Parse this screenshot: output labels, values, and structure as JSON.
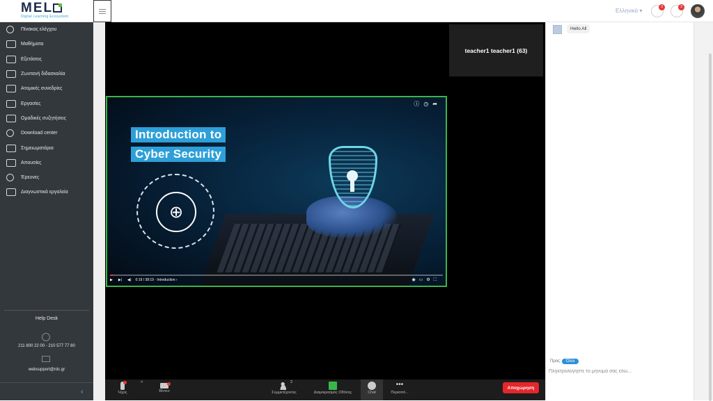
{
  "app": {
    "logo_word": "MEL",
    "logo_tag": "Digital Learning Ecosystem",
    "language": "Ελληνικά ▾",
    "notif_badges": [
      "3",
      "3"
    ]
  },
  "sidebar": {
    "items": [
      {
        "label": "Πίνακας ελέγχου",
        "icon": "dashboard-gauge-icon"
      },
      {
        "label": "Μαθήματα",
        "icon": "courses-icon"
      },
      {
        "label": "Εξετάσεις",
        "icon": "exams-icon"
      },
      {
        "label": "Ζωντανή διδασκαλία",
        "icon": "live-teaching-icon"
      },
      {
        "label": "Ατομικές συνεδρίες",
        "icon": "individual-sessions-icon"
      },
      {
        "label": "Εργασίες",
        "icon": "assignments-icon"
      },
      {
        "label": "Ομαδικές συζητήσεις",
        "icon": "group-discussions-icon"
      },
      {
        "label": "Download center",
        "icon": "download-center-icon"
      },
      {
        "label": "Σημειωματάρια",
        "icon": "notebooks-icon"
      },
      {
        "label": "Απουσίες",
        "icon": "absences-icon"
      },
      {
        "label": "Έρευνες",
        "icon": "surveys-icon"
      },
      {
        "label": "Διαγνωστικά εργαλεία",
        "icon": "diagnostic-tools-icon"
      }
    ],
    "help_desk": "Help Desk",
    "phone": "211 800 22 00 - 210 577 77 80",
    "email": "websupport@rdc.gr"
  },
  "meeting": {
    "participant_tile": "teacher1 teacher1 (63)",
    "video": {
      "title_line1": "Introduction to",
      "title_line2": "Cyber Security",
      "time": "0:19 / 38:19 · Introduction ›",
      "progress": 0.01
    },
    "controls": {
      "mic_label": "Ήχος",
      "video_label": "Βίντεο",
      "participants_label": "Συμμετέχοντες",
      "participants_count": "2",
      "share_label": "Διαμοιρασμός Οθόνης",
      "chat_label": "Chat",
      "more_label": "Περισσό...",
      "leave_label": "Αποχώρηση"
    }
  },
  "chat": {
    "messages": [
      {
        "text": "Hello All"
      }
    ],
    "to_label": "Προς:",
    "to_value": "Όλοι",
    "input_placeholder": "Πληκτρολογήστε το μήνυμά σας εδώ..."
  },
  "colors": {
    "sidebar_bg": "#33383c",
    "share_border": "#3bb54a",
    "leave_button": "#e5262b",
    "accent_blue": "#2e9fd8"
  }
}
